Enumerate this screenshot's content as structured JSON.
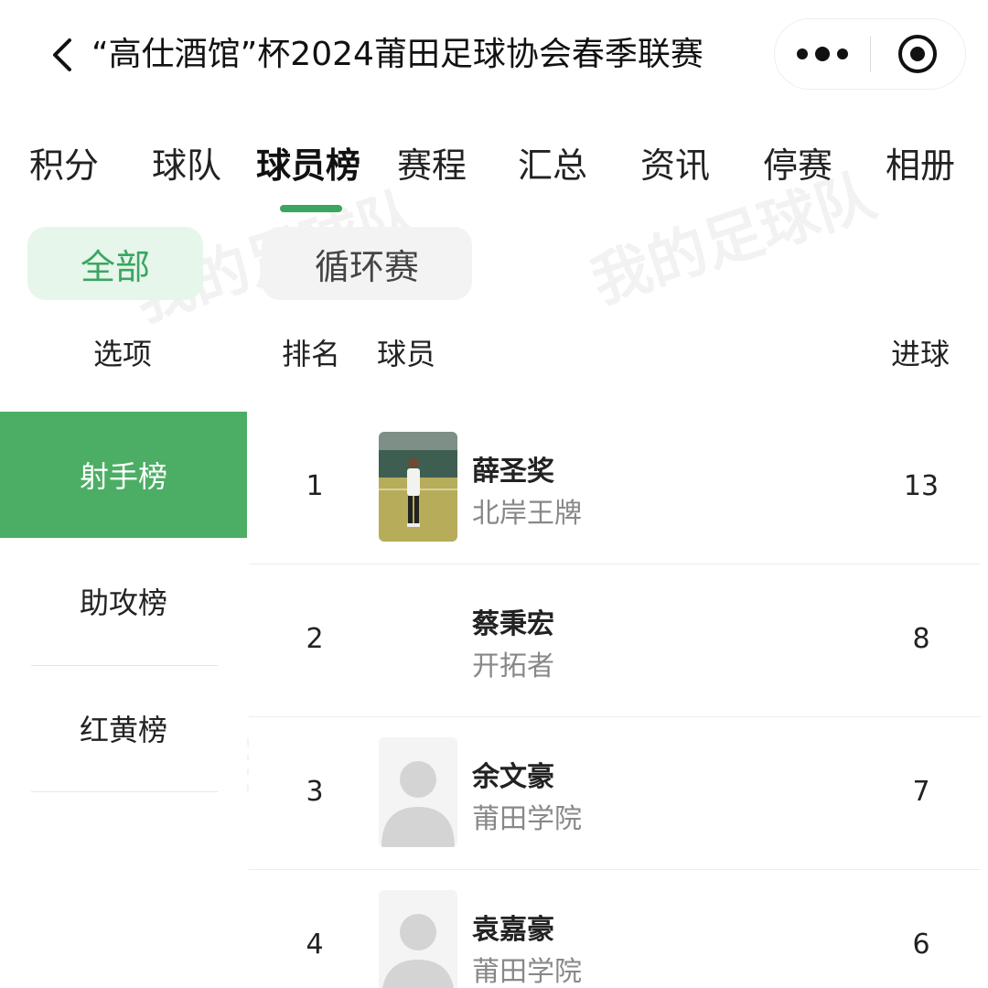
{
  "header": {
    "title": "“高仕酒馆”杯2024莆田足球协会春季联赛"
  },
  "tabs": [
    {
      "label": "积分"
    },
    {
      "label": "球队"
    },
    {
      "label": "球员榜"
    },
    {
      "label": "赛程"
    },
    {
      "label": "汇总"
    },
    {
      "label": "资讯"
    },
    {
      "label": "停赛"
    },
    {
      "label": "相册"
    }
  ],
  "filters": {
    "all": "全部",
    "round_robin": "循环赛"
  },
  "columns": {
    "options": "选项",
    "rank": "排名",
    "player": "球员",
    "goals": "进球"
  },
  "sidebar": {
    "items": [
      {
        "label": "射手榜"
      },
      {
        "label": "助攻榜"
      },
      {
        "label": "红黄榜"
      }
    ]
  },
  "rows": [
    {
      "rank": "1",
      "name": "薛圣奖",
      "team": "北岸王牌",
      "goals": "13"
    },
    {
      "rank": "2",
      "name": "蔡秉宏",
      "team": "开拓者",
      "goals": "8"
    },
    {
      "rank": "3",
      "name": "余文豪",
      "team": "莆田学院",
      "goals": "7"
    },
    {
      "rank": "4",
      "name": "袁嘉豪",
      "team": "莆田学院",
      "goals": "6"
    }
  ],
  "watermark": "我的足球队",
  "colors": {
    "accent": "#4cae64",
    "accent_light": "#e6f6eb",
    "muted_text": "#888888"
  }
}
